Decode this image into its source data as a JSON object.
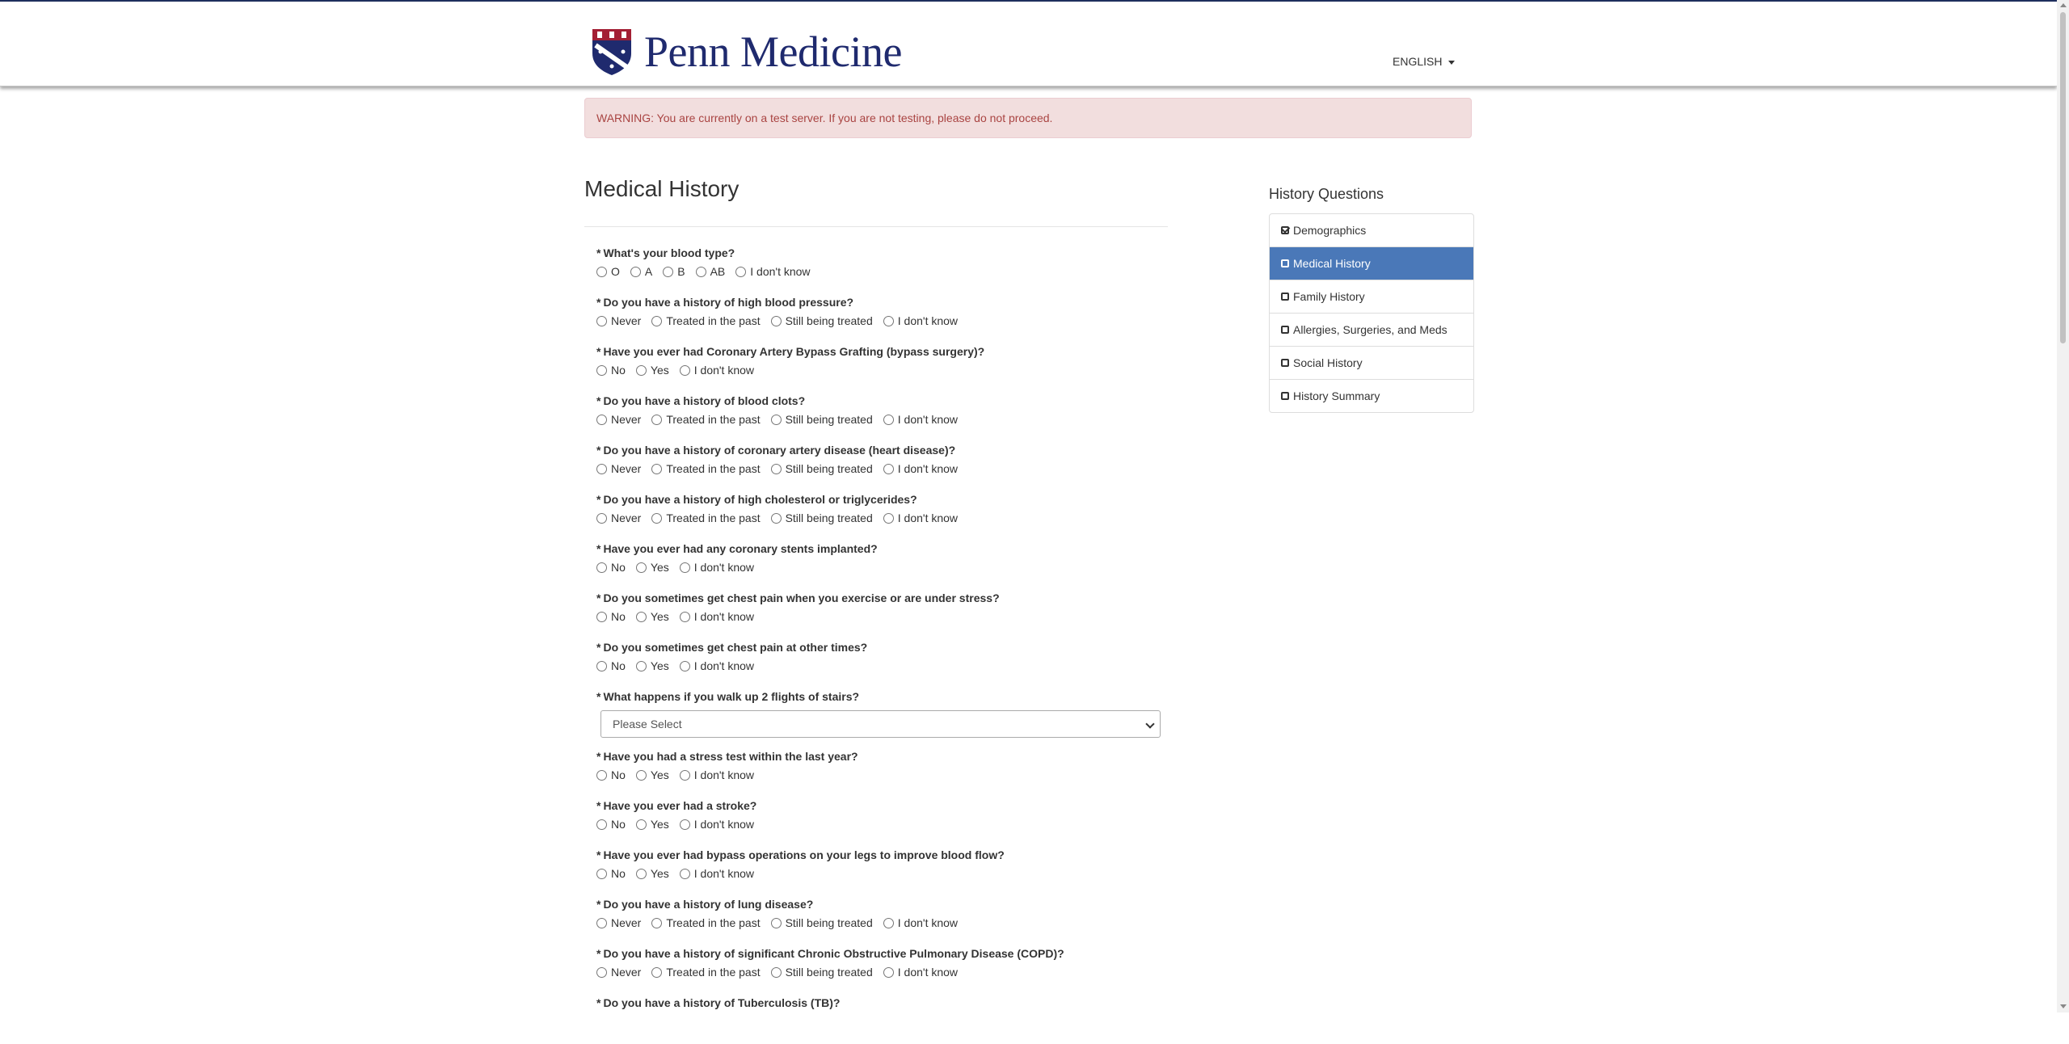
{
  "header": {
    "brand": "Penn Medicine",
    "language": "ENGLISH"
  },
  "warning": "WARNING: You are currently on a test server. If you are not testing, please do not proceed.",
  "page_title": "Medical History",
  "questions": [
    {
      "label": "What's your blood type?",
      "options": [
        "O",
        "A",
        "B",
        "AB",
        "I don't know"
      ]
    },
    {
      "label": "Do you have a history of high blood pressure?",
      "options": [
        "Never",
        "Treated in the past",
        "Still being treated",
        "I don't know"
      ]
    },
    {
      "label": "Have you ever had Coronary Artery Bypass Grafting (bypass surgery)?",
      "options": [
        "No",
        "Yes",
        "I don't know"
      ]
    },
    {
      "label": "Do you have a history of blood clots?",
      "options": [
        "Never",
        "Treated in the past",
        "Still being treated",
        "I don't know"
      ]
    },
    {
      "label": "Do you have a history of coronary artery disease (heart disease)?",
      "options": [
        "Never",
        "Treated in the past",
        "Still being treated",
        "I don't know"
      ]
    },
    {
      "label": "Do you have a history of high cholesterol or triglycerides?",
      "options": [
        "Never",
        "Treated in the past",
        "Still being treated",
        "I don't know"
      ]
    },
    {
      "label": "Have you ever had any coronary stents implanted?",
      "options": [
        "No",
        "Yes",
        "I don't know"
      ]
    },
    {
      "label": "Do you sometimes get chest pain when you exercise or are under stress?",
      "options": [
        "No",
        "Yes",
        "I don't know"
      ]
    },
    {
      "label": "Do you sometimes get chest pain at other times?",
      "options": [
        "No",
        "Yes",
        "I don't know"
      ]
    },
    {
      "label": "What happens if you walk up 2 flights of stairs?",
      "select": "Please Select"
    },
    {
      "label": "Have you had a stress test within the last year?",
      "options": [
        "No",
        "Yes",
        "I don't know"
      ]
    },
    {
      "label": "Have you ever had a stroke?",
      "options": [
        "No",
        "Yes",
        "I don't know"
      ]
    },
    {
      "label": "Have you ever had bypass operations on your legs to improve blood flow?",
      "options": [
        "No",
        "Yes",
        "I don't know"
      ]
    },
    {
      "label": "Do you have a history of lung disease?",
      "options": [
        "Never",
        "Treated in the past",
        "Still being treated",
        "I don't know"
      ]
    },
    {
      "label": "Do you have a history of significant Chronic Obstructive Pulmonary Disease (COPD)?",
      "options": [
        "Never",
        "Treated in the past",
        "Still being treated",
        "I don't know"
      ]
    },
    {
      "label": "Do you have a history of Tuberculosis (TB)?",
      "options": []
    }
  ],
  "sidebar": {
    "title": "History Questions",
    "items": [
      {
        "label": "Demographics",
        "state": "checked"
      },
      {
        "label": "Medical History",
        "state": "active"
      },
      {
        "label": "Family History",
        "state": "unchecked"
      },
      {
        "label": "Allergies, Surgeries, and Meds",
        "state": "unchecked"
      },
      {
        "label": "Social History",
        "state": "unchecked"
      },
      {
        "label": "History Summary",
        "state": "unchecked"
      }
    ]
  },
  "colors": {
    "brand_navy": "#1f2a6e",
    "active_item": "#4a78b8",
    "warning_bg": "#f2dede",
    "warning_text": "#a94442"
  }
}
